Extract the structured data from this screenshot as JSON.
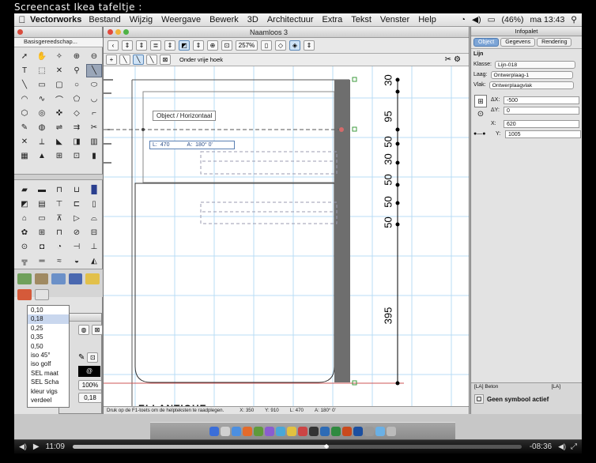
{
  "caption": "Screencast Ikea tafeltje :",
  "menubar": {
    "app": "Vectorworks",
    "items": [
      "Bestand",
      "Wijzig",
      "Weergave",
      "Bewerk",
      "3D",
      "Architectuur",
      "Extra",
      "Tekst",
      "Venster",
      "Help"
    ],
    "battery": "(46%)",
    "clock": "ma 13:43"
  },
  "tool_palette": {
    "title": "Basisgereedschap..."
  },
  "line_weights": [
    "0,10",
    "0,18",
    "0,25",
    "0,35",
    "0,50",
    "iso 45°",
    "iso golf",
    "SEL maat",
    "SEL Scha",
    "kleur vigs",
    "verdeel"
  ],
  "attr_panel": {
    "zoom_percent": "100%",
    "line_value": "0,18"
  },
  "drawing_window": {
    "title": "Naamloos 3",
    "zoom": "257%",
    "mode_label": "Onder vrije hoek",
    "tooltip_snap": "Object  /  Horizontaal",
    "tooltip_length_label": "L:",
    "tooltip_length": "470",
    "tooltip_angle_label": "A:",
    "tooltip_angle": "180° 0'",
    "dimensions": [
      "30",
      "95",
      "50",
      "30",
      "50",
      "50",
      "50",
      "395"
    ],
    "partial_text": "ELLANTIQUE",
    "status": {
      "hint": "Druk op de F1-toets om de helpteksten te raadplegen.",
      "x_label": "X:",
      "x": "350",
      "y_label": "Y:",
      "y": "910",
      "l_label": "L:",
      "l": "470",
      "a_label": "A:",
      "a": "180° 0'"
    }
  },
  "info_palette": {
    "title": "Infopalet",
    "tabs": [
      "Object",
      "Gegevens",
      "Rendering"
    ],
    "object_type": "Lijn",
    "klasse_label": "Klasse:",
    "klasse": "Lijn-018",
    "laag_label": "Laag:",
    "laag": "Ontwerplaag-1",
    "vlak_label": "Vlak:",
    "vlak": "Ontwerplaagvlak",
    "dx_label": "ΔX:",
    "dx": "-500",
    "dy_label": "ΔY:",
    "dy": "0",
    "x_label": "X:",
    "x": "620",
    "y_label": "Y:",
    "y": "1005",
    "bottom_left": "[LA] Beton",
    "bottom_right": "[LA]",
    "symbol_status": "Geen symbool actief"
  },
  "player": {
    "elapsed": "11:09",
    "remaining": "-08:36"
  },
  "colors": {
    "menubar_bg": "#e8e8e8",
    "selection_blue": "#7da5d6",
    "grid_blue": "#a9d3f2",
    "dark_wall": "#6e6e6e"
  }
}
